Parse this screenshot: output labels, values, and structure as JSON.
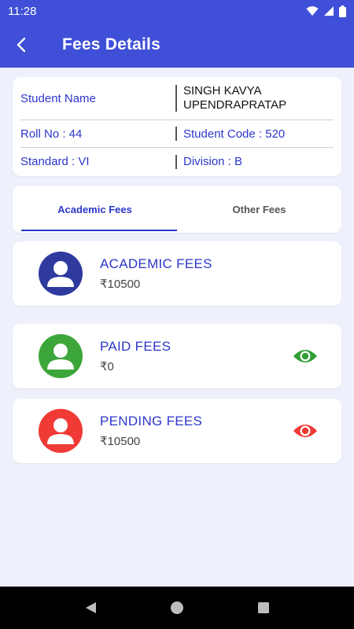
{
  "status_bar": {
    "time": "11:28"
  },
  "app_bar": {
    "title": "Fees Details"
  },
  "student": {
    "name_label": "Student Name",
    "name_value": "SINGH KAVYA UPENDRAPRATAP",
    "roll_no": "Roll No : 44",
    "student_code": "Student Code : 520",
    "standard": "Standard : VI",
    "division": "Division : B"
  },
  "tabs": [
    {
      "label": "Academic Fees",
      "active": true
    },
    {
      "label": "Other Fees",
      "active": false
    }
  ],
  "fees": [
    {
      "title": "ACADEMIC FEES",
      "amount": "₹10500",
      "color": "#2e3a9e",
      "icon": "user-avatar-icon",
      "has_view": false
    },
    {
      "title": "PAID FEES",
      "amount": "₹0",
      "color": "#3ca63a",
      "icon": "user-avatar-icon",
      "has_view": true,
      "view_color": "#2e9e33"
    },
    {
      "title": "PENDING FEES",
      "amount": "₹10500",
      "color": "#f03a36",
      "icon": "user-avatar-icon",
      "has_view": true,
      "view_color": "#f03a36"
    }
  ],
  "colors": {
    "primary": "#3f4fd8",
    "accent_text": "#2c37c9",
    "background": "#eef1fc"
  }
}
